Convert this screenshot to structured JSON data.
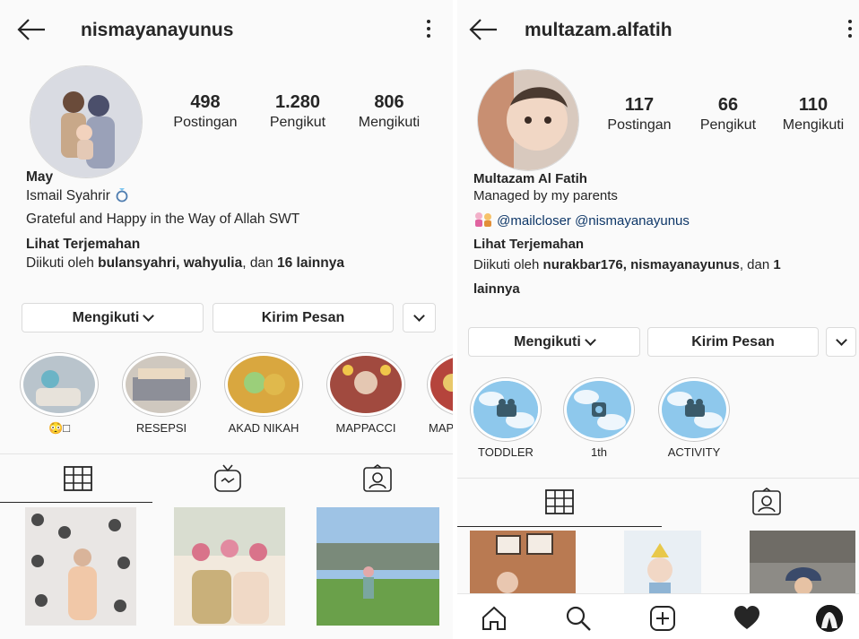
{
  "left": {
    "username": "nismayanayunus",
    "stats": [
      {
        "value": "498",
        "label": "Postingan"
      },
      {
        "value": "1.280",
        "label": "Pengikut"
      },
      {
        "value": "806",
        "label": "Mengikuti"
      }
    ],
    "name": "May",
    "bio_line1": "Ismail Syahrir",
    "bio_line2": "Grateful and Happy in the Way of Allah SWT",
    "translate": "Lihat Terjemahan",
    "followed_prefix": "Diikuti oleh ",
    "followed_users": "bulansyahri, wahyulia",
    "followed_mid": ", dan ",
    "followed_others": "16 lainnya",
    "buttons": {
      "following": "Mengikuti",
      "message": "Kirim Pesan"
    },
    "highlights": [
      "😳□",
      "RESEPSI",
      "AKAD NIKAH",
      "MAPPACCI",
      "MAP"
    ],
    "tab_icons": [
      "grid-icon",
      "igtv-icon",
      "tagged-icon"
    ]
  },
  "right": {
    "username": "multazam.alfatih",
    "stats": [
      {
        "value": "117",
        "label": "Postingan"
      },
      {
        "value": "66",
        "label": "Pengikut"
      },
      {
        "value": "110",
        "label": "Mengikuti"
      }
    ],
    "name": "Multazam Al Fatih",
    "bio_line1": "Managed by my parents",
    "mentions": "@mailcloser @nismayanayunus",
    "translate": "Lihat Terjemahan",
    "followed_prefix": "Diikuti oleh ",
    "followed_users": "nurakbar176, nismayanayunus",
    "followed_mid": ", dan ",
    "followed_others_1": "1",
    "followed_others_2": "lainnya",
    "buttons": {
      "following": "Mengikuti",
      "message": "Kirim Pesan"
    },
    "highlights": [
      "TODDLER",
      "1th",
      "ACTIVITY"
    ],
    "tab_icons": [
      "grid-icon",
      "tagged-icon"
    ],
    "nav_icons": [
      "home-icon",
      "search-icon",
      "add-post-icon",
      "heart-icon",
      "profile-avatar-icon"
    ]
  }
}
